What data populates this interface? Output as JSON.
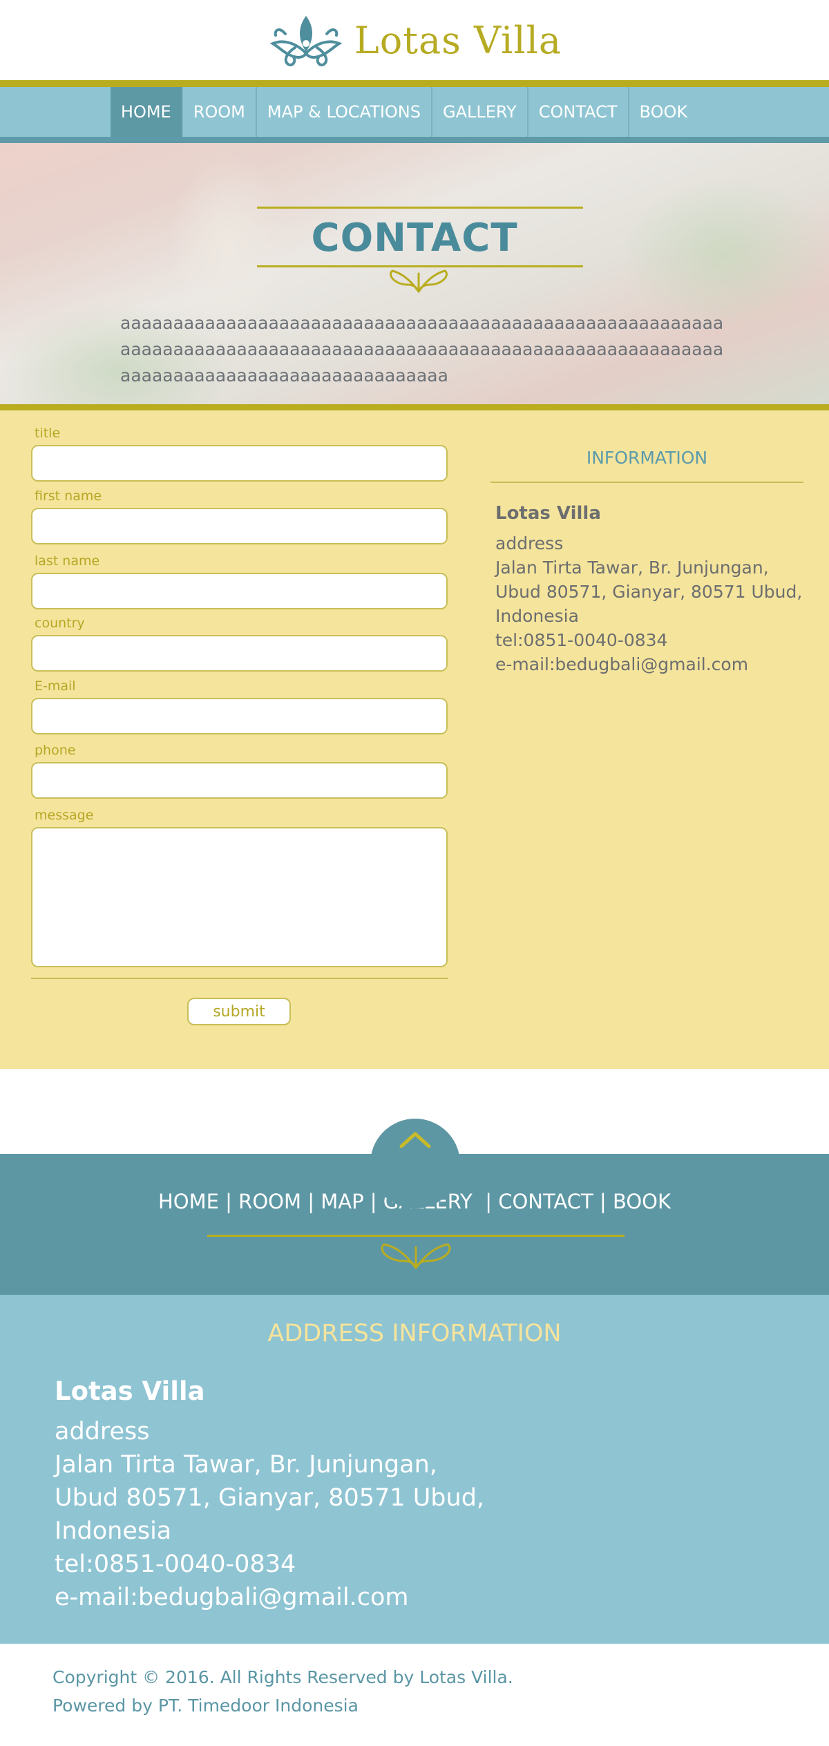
{
  "brand": {
    "name": "Lotas Villa",
    "primary": "#5e97a4",
    "light_blue": "#8fc5d3",
    "gold": "#b9ad1f",
    "cream": "#f5e49c"
  },
  "nav": {
    "items": [
      "HOME",
      "ROOM",
      "MAP &  LOCATIONS",
      "GALLERY",
      "CONTACT",
      "BOOK"
    ],
    "active": "HOME"
  },
  "hero": {
    "title": "CONTACT",
    "text": "aaaaaaaaaaaaaaaaaaaaaaaaaaaaaaaaaaaaaaaaaaaaaaaaaaaaaaaaaaaaaaaaaaaaaaaaaaaaaaaaaaaaaaaaaaaaaaaaaaaaaaaaaaaaaaaaaaaaaaaaaaaaaaaaaaaaaaaaaaaaaaaaa"
  },
  "form": {
    "fields": [
      {
        "label": "title",
        "value": ""
      },
      {
        "label": "first name",
        "value": ""
      },
      {
        "label": "last name",
        "value": ""
      },
      {
        "label": "country",
        "value": ""
      },
      {
        "label": "E-mail",
        "value": ""
      },
      {
        "label": "phone",
        "value": ""
      }
    ],
    "message_label": "message",
    "message_value": "",
    "submit_label": "submit"
  },
  "information": {
    "heading": "INFORMATION",
    "name": "Lotas Villa",
    "lines": [
      "address",
      "Jalan Tirta Tawar, Br. Junjungan,",
      "Ubud 80571, Gianyar, 80571 Ubud,",
      "Indonesia",
      "tel:0851-0040-0834",
      "e-mail:bedugbali@gmail.com"
    ]
  },
  "footer_nav": {
    "items": [
      "HOME",
      "ROOM",
      "MAP",
      "GALLERY ",
      "CONTACT",
      "BOOK"
    ],
    "separator": " | "
  },
  "address_info": {
    "heading": "ADDRESS INFORMATION",
    "name": "Lotas Villa",
    "lines": [
      "address",
      "Jalan Tirta Tawar, Br. Junjungan,",
      "Ubud 80571, Gianyar, 80571 Ubud,",
      "Indonesia",
      "tel:0851-0040-0834",
      "e-mail:bedugbali@gmail.com"
    ]
  },
  "copyright": {
    "line1": "Copyright © 2016. All Rights Reserved by Lotas Villa.",
    "line2": "Powered by PT. Timedoor Indonesia"
  },
  "icons": {
    "logo": "lotus-logo-icon",
    "scroll_top": "chevron-up-icon",
    "ornament": "flourish-ornament-icon"
  }
}
